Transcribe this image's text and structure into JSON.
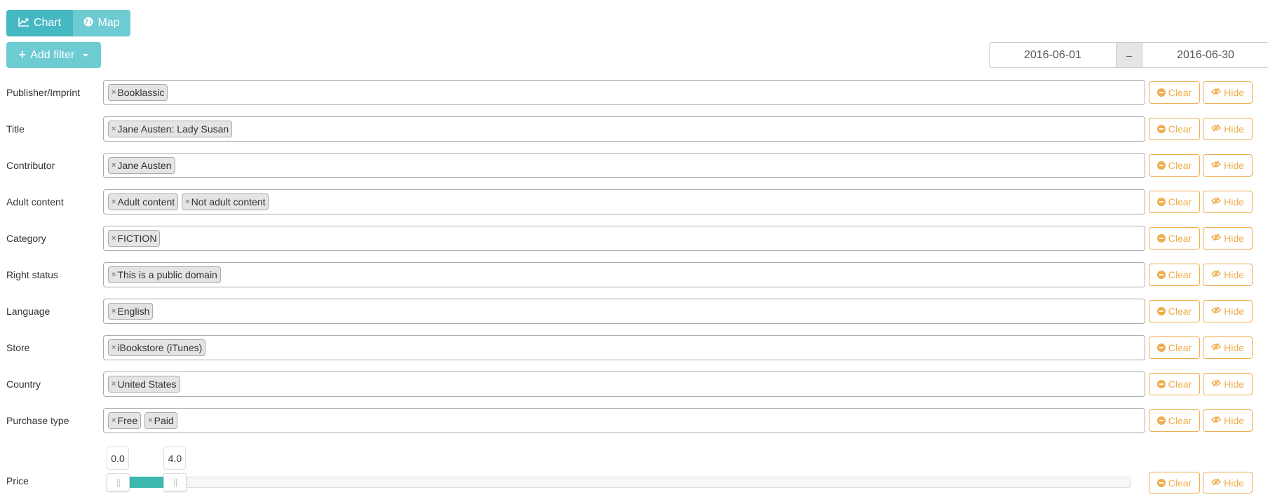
{
  "view_toggle": {
    "chart_label": "Chart",
    "map_label": "Map",
    "active": "chart"
  },
  "add_filter": {
    "label": "Add filter"
  },
  "date_range": {
    "start": "2016-06-01",
    "separator": "–",
    "end": "2016-06-30"
  },
  "buttons": {
    "clear": "Clear",
    "hide": "Hide"
  },
  "filters": [
    {
      "label": "Publisher/Imprint",
      "tags": [
        "Booklassic"
      ]
    },
    {
      "label": "Title",
      "tags": [
        "Jane Austen: Lady Susan"
      ]
    },
    {
      "label": "Contributor",
      "tags": [
        "Jane Austen"
      ]
    },
    {
      "label": "Adult content",
      "tags": [
        "Adult content",
        "Not adult content"
      ]
    },
    {
      "label": "Category",
      "tags": [
        "FICTION"
      ]
    },
    {
      "label": "Right status",
      "tags": [
        "This is a public domain"
      ]
    },
    {
      "label": "Language",
      "tags": [
        "English"
      ]
    },
    {
      "label": "Store",
      "tags": [
        "iBookstore (iTunes)"
      ]
    },
    {
      "label": "Country",
      "tags": [
        "United States"
      ]
    },
    {
      "label": "Purchase type",
      "tags": [
        "Free",
        "Paid"
      ]
    }
  ],
  "price": {
    "label": "Price",
    "min_value": "0.0",
    "max_value": "4.0",
    "min_fraction": 0.0,
    "max_fraction": 0.057
  },
  "colors": {
    "accent_teal": "#46b8c2",
    "accent_teal_light": "#6dcbd2",
    "warning_orange": "#f0ad4e",
    "slider_fill": "#3fb8af"
  }
}
